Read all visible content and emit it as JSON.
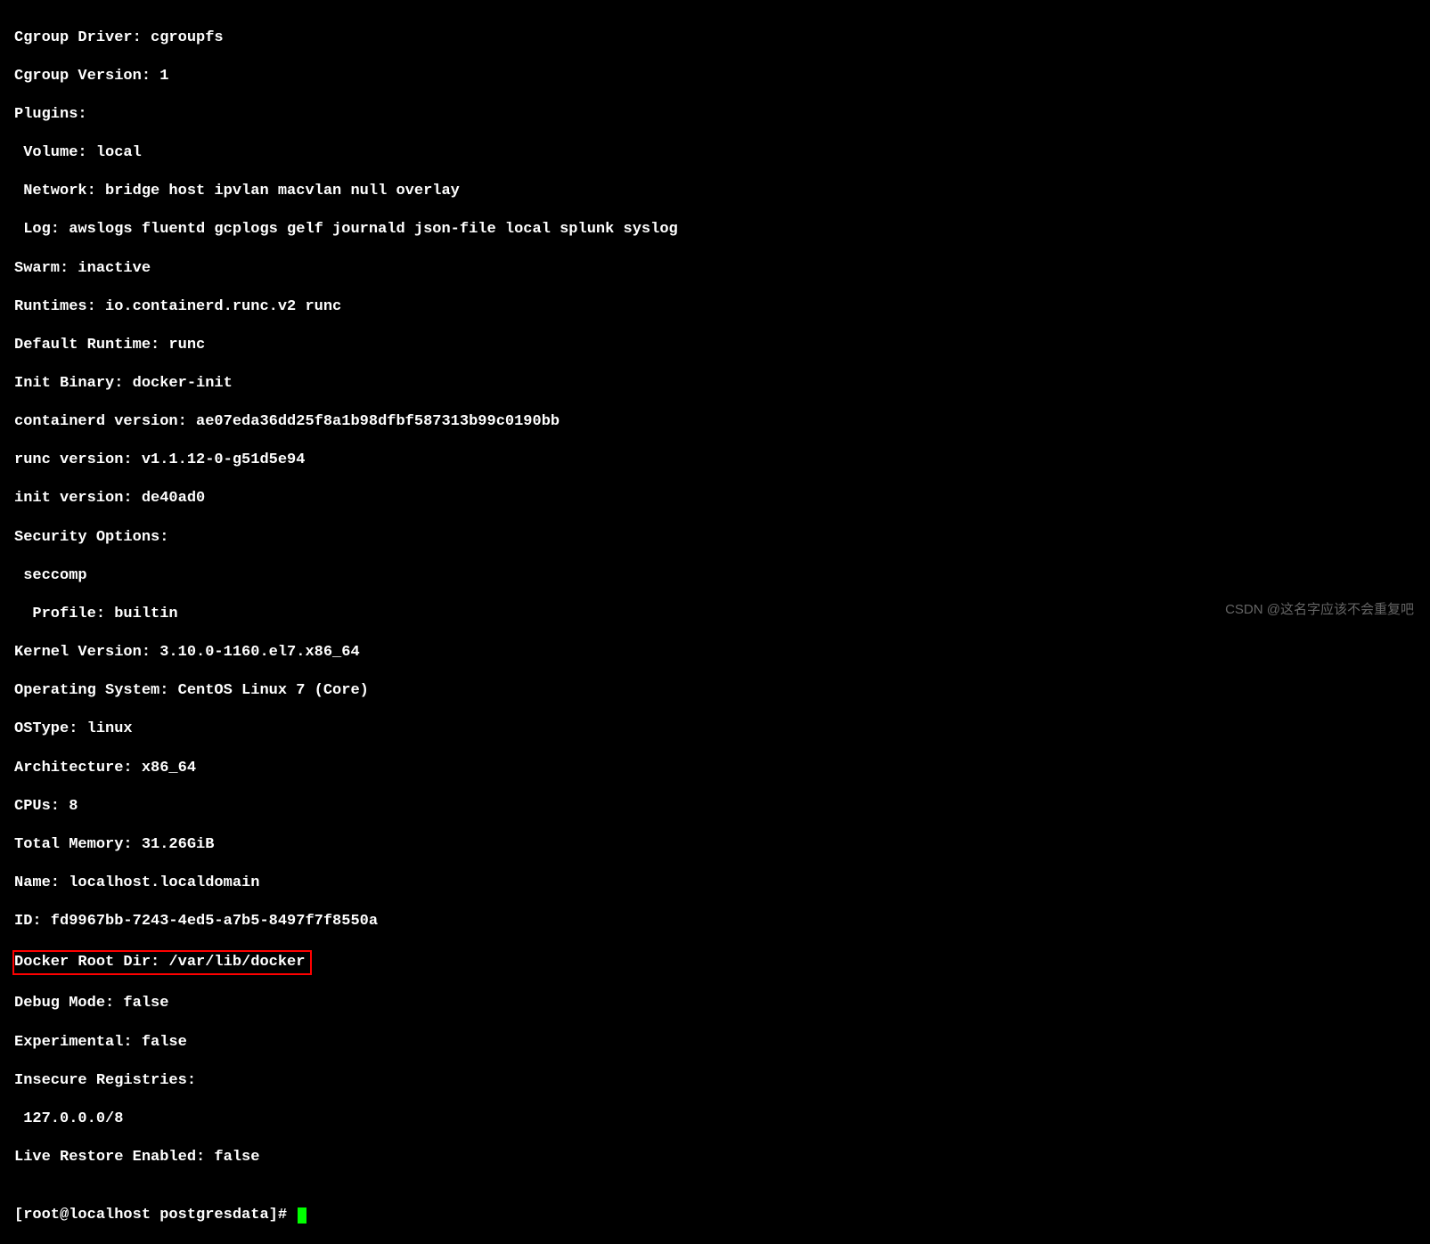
{
  "terminal": {
    "lines": [
      "Cgroup Driver: cgroupfs",
      "Cgroup Version: 1",
      "Plugins:",
      " Volume: local",
      " Network: bridge host ipvlan macvlan null overlay",
      " Log: awslogs fluentd gcplogs gelf journald json-file local splunk syslog",
      "Swarm: inactive",
      "Runtimes: io.containerd.runc.v2 runc",
      "Default Runtime: runc",
      "Init Binary: docker-init",
      "containerd version: ae07eda36dd25f8a1b98dfbf587313b99c0190bb",
      "runc version: v1.1.12-0-g51d5e94",
      "init version: de40ad0",
      "Security Options:",
      " seccomp",
      "  Profile: builtin",
      "Kernel Version: 3.10.0-1160.el7.x86_64",
      "Operating System: CentOS Linux 7 (Core)",
      "OSType: linux",
      "Architecture: x86_64",
      "CPUs: 8",
      "Total Memory: 31.26GiB",
      "Name: localhost.localdomain",
      "ID: fd9967bb-7243-4ed5-a7b5-8497f7f8550a"
    ],
    "highlighted_line": "Docker Root Dir: /var/lib/docker",
    "lines_after": [
      "Debug Mode: false",
      "Experimental: false",
      "Insecure Registries:",
      " 127.0.0.0/8",
      "Live Restore Enabled: false",
      ""
    ],
    "prompt": "[root@localhost postgresdata]# "
  },
  "watermark": "CSDN @这名字应该不会重复吧"
}
